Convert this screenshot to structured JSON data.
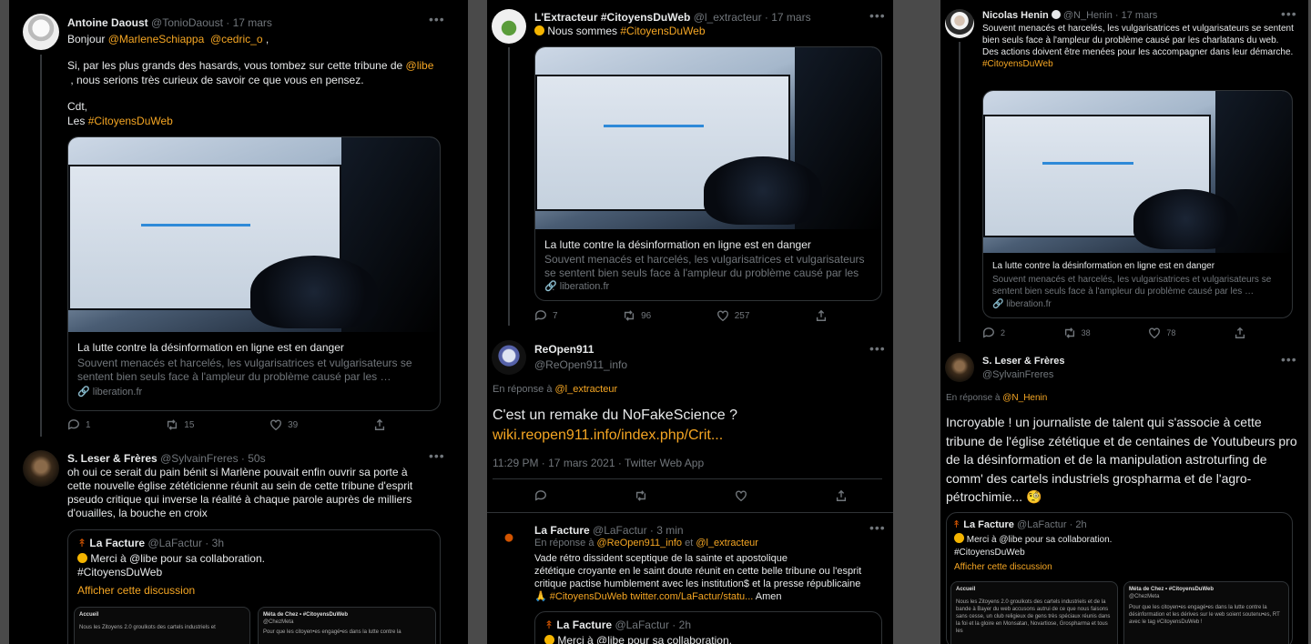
{
  "card": {
    "title": "La lutte contre la désinformation en ligne est en danger",
    "desc": "Souvent menacés et harcelés, les vulgarisatrices et vulgarisateurs se sentent bien seuls face à l'ampleur du problème causé par les …",
    "domain": "liberation.fr"
  },
  "col1": {
    "t1": {
      "name": "Antoine Daoust",
      "handle": "@TonioDaoust · 17 mars",
      "line1_prefix": "Bonjour ",
      "mention1": "@MarleneSchiappa",
      "mention2": "@cedric_o",
      "line1_suffix": " ,",
      "line2_prefix": "Si, par les plus grands des hasards, vous tombez sur cette tribune de ",
      "mention3": "@libe",
      "line3": ", nous serions très curieux de savoir ce que vous en pensez.",
      "line4": "Cdt,",
      "line5_prefix": "Les ",
      "hashtag": "#CitoyensDuWeb",
      "replies": "1",
      "retweets": "15",
      "likes": "39"
    },
    "t2": {
      "name": "S. Leser & Frères",
      "handle": "@SylvainFreres · 50s",
      "text": "oh oui ce serait du pain bénit si Marlène pouvait enfin ouvrir sa porte à cette nouvelle église zététicienne réunit au sein de cette tribune d'esprit pseudo critique qui inverse la réalité à chaque parole auprès de milliers d'ouailles, la bouche en croix",
      "quote_name": "La Facture",
      "quote_handle": "@LaFactur · 3h",
      "quote_text": "Merci à @libe pour sa collaboration.",
      "quote_hashtag": "#CitoyensDuWeb",
      "quote_link": "Afficher cette discussion",
      "mini1_title": "Accueil",
      "mini1_text": "Nous les Zitoyens 2.0 groulkots des cartels industriels et",
      "mini2_title": "Méta de Chez • #CitoyensDuWeb",
      "mini2_handle": "@ChezMeta",
      "mini2_text": "Pour que les citoyen•es engagé•es dans la lutte contre la"
    }
  },
  "col2": {
    "t1": {
      "name": "L'Extracteur #CitoyensDuWeb",
      "handle": "@l_extracteur · 17 mars",
      "text_prefix": "Nous sommes ",
      "hashtag": "#CitoyensDuWeb",
      "replies": "7",
      "retweets": "96",
      "likes": "257"
    },
    "t2": {
      "name": "ReOpen911",
      "handle": "@ReOpen911_info",
      "reply_prefix": "En réponse à ",
      "reply_to": "@l_extracteur",
      "text": "C'est un remake du NoFakeScience ?",
      "url": "wiki.reopen911.info/index.php/Crit...",
      "meta": "11:29 PM · 17 mars 2021 · Twitter Web App"
    },
    "t3": {
      "name": "La Facture",
      "handle": "@LaFactur · 3 min",
      "reply_prefix": "En réponse à ",
      "reply_to1": "@ReOpen911_info",
      "reply_and": " et ",
      "reply_to2": "@l_extracteur",
      "text1": "Vade rétro dissident sceptique de la sainte et apostolique",
      "text2": "zététique croyante en le saint doute réunit en cette belle tribune ou l'esprit",
      "text3": "critique pactise humblement avec les institution$ et la presse républicaine",
      "hashtag": "#CitoyensDuWeb",
      "url": "twitter.com/LaFactur/statu...",
      "tail": " Amen",
      "quote_name": "La Facture",
      "quote_handle": "@LaFactur · 2h",
      "quote_text": "Merci à @libe pour sa collaboration."
    }
  },
  "col3": {
    "t1": {
      "name": "Nicolas Henin",
      "handle": "@N_Henin · 17 mars",
      "text": "Souvent menacés et harcelés, les vulgarisatrices et vulgarisateurs se sentent bien seuls face à l'ampleur du problème causé par les charlatans du web. Des actions doivent être menées pour les accompagner dans leur démarche.",
      "hashtag": "#CitoyensDuWeb",
      "replies": "2",
      "retweets": "38",
      "likes": "78"
    },
    "t2": {
      "name": "S. Leser & Frères",
      "handle": "@SylvainFreres",
      "reply_prefix": "En réponse à ",
      "reply_to": "@N_Henin",
      "text": "Incroyable ! un journaliste de talent qui s'associe à cette tribune de l'église zététique et de centaines de Youtubeurs pro de la désinformation et de la manipulation astroturfing de comm' des cartels industriels grospharma et de l'agro-pétrochimie...",
      "quote_name": "La Facture",
      "quote_handle": "@LaFactur · 2h",
      "quote_text": "Merci à @libe pour sa collaboration.",
      "quote_hashtag": "#CitoyensDuWeb",
      "quote_link": "Afficher cette discussion",
      "mini1_title": "Accueil",
      "mini1_text": "Nous les Zitoyens 2.0 groulkots des cartels industriels et de la bande à Bayer du web accusons autrui de ce que nous faisons sans cesse, un club religieux de gens très spéciaux réunis dans la foi et la gloire en Monsatan, Novartiose, Grospharma et tous les",
      "mini2_title": "Méta de Chez • #CitoyensDuWeb",
      "mini2_handle": "@ChezMeta",
      "mini2_text": "Pour que les citoyen•es engagé•es dans la lutte contre la désinformation et les dérives sur le web soient soutenu•es, RT avec le tag #CitoyensDuWeb !"
    }
  }
}
